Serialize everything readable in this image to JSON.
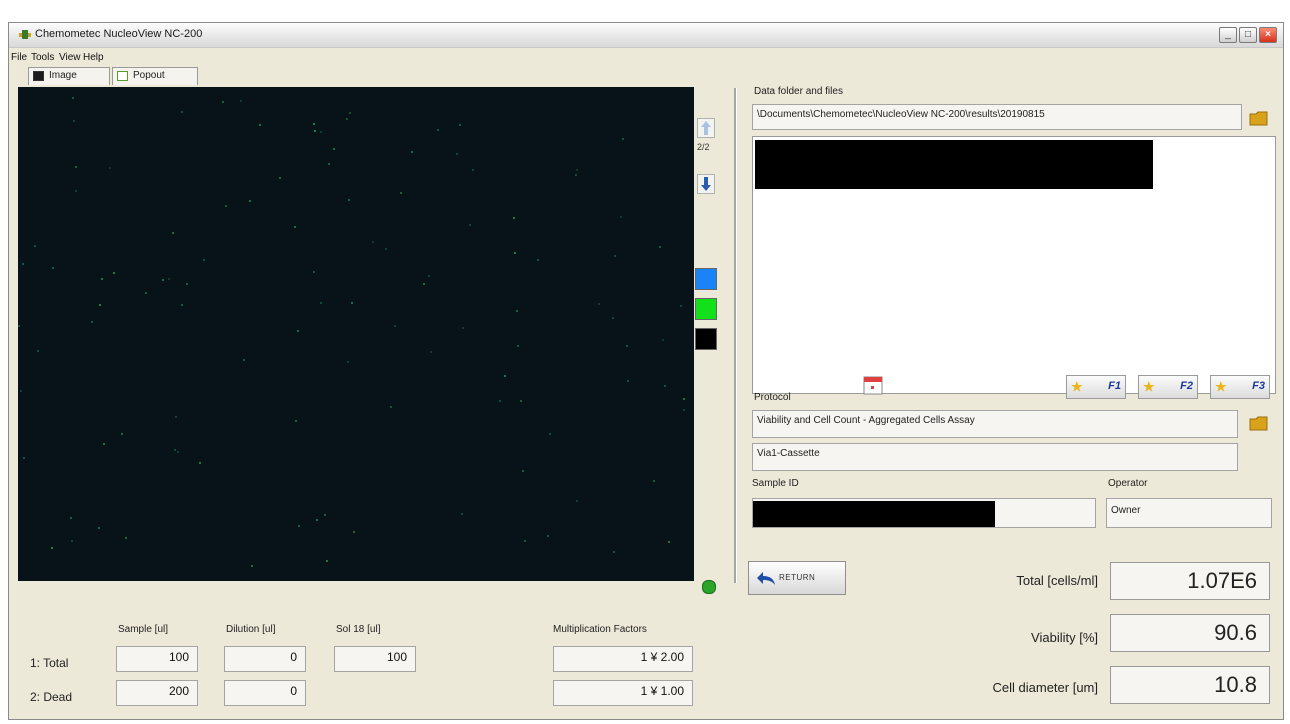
{
  "window": {
    "title": "Chemometec NucleoView NC-200"
  },
  "menu": [
    "File",
    "Tools",
    "View",
    "Help"
  ],
  "tabs": [
    {
      "label": "Image"
    },
    {
      "label": "Popout"
    }
  ],
  "image_nav": {
    "page": "2/2"
  },
  "swatch_colors": [
    "#1a84f7",
    "#12e01a",
    "#000000"
  ],
  "data_folder": {
    "label": "Data folder and files",
    "path": "\\Documents\\Chemometec\\NucleoView NC-200\\results\\20190815"
  },
  "protocol": {
    "label": "Protocol",
    "f_buttons": [
      "F1",
      "F2",
      "F3"
    ],
    "name": "Viability and Cell Count - Aggregated Cells Assay",
    "cassette": "Via1-Cassette"
  },
  "sample": {
    "id_label": "Sample ID"
  },
  "operator": {
    "label": "Operator",
    "value": "Owner"
  },
  "return_button": "RETURN",
  "results": {
    "total_label": "Total [cells/ml]",
    "total_value": "1.07E6",
    "viability_label": "Viability [%]",
    "viability_value": "90.6",
    "diameter_label": "Cell diameter [um]",
    "diameter_value": "10.8"
  },
  "dilution": {
    "headers": {
      "sample": "Sample [ul]",
      "dilution": "Dilution [ul]",
      "sol18": "Sol 18 [ul]",
      "multiplication": "Multiplication Factors"
    },
    "rows": [
      {
        "label": "1: Total",
        "sample": "100",
        "dilution": "0",
        "sol18": "100",
        "factor": "1 ¥ 2.00"
      },
      {
        "label": "2: Dead",
        "sample": "200",
        "dilution": "0",
        "factor": "1 ¥ 1.00"
      }
    ]
  }
}
